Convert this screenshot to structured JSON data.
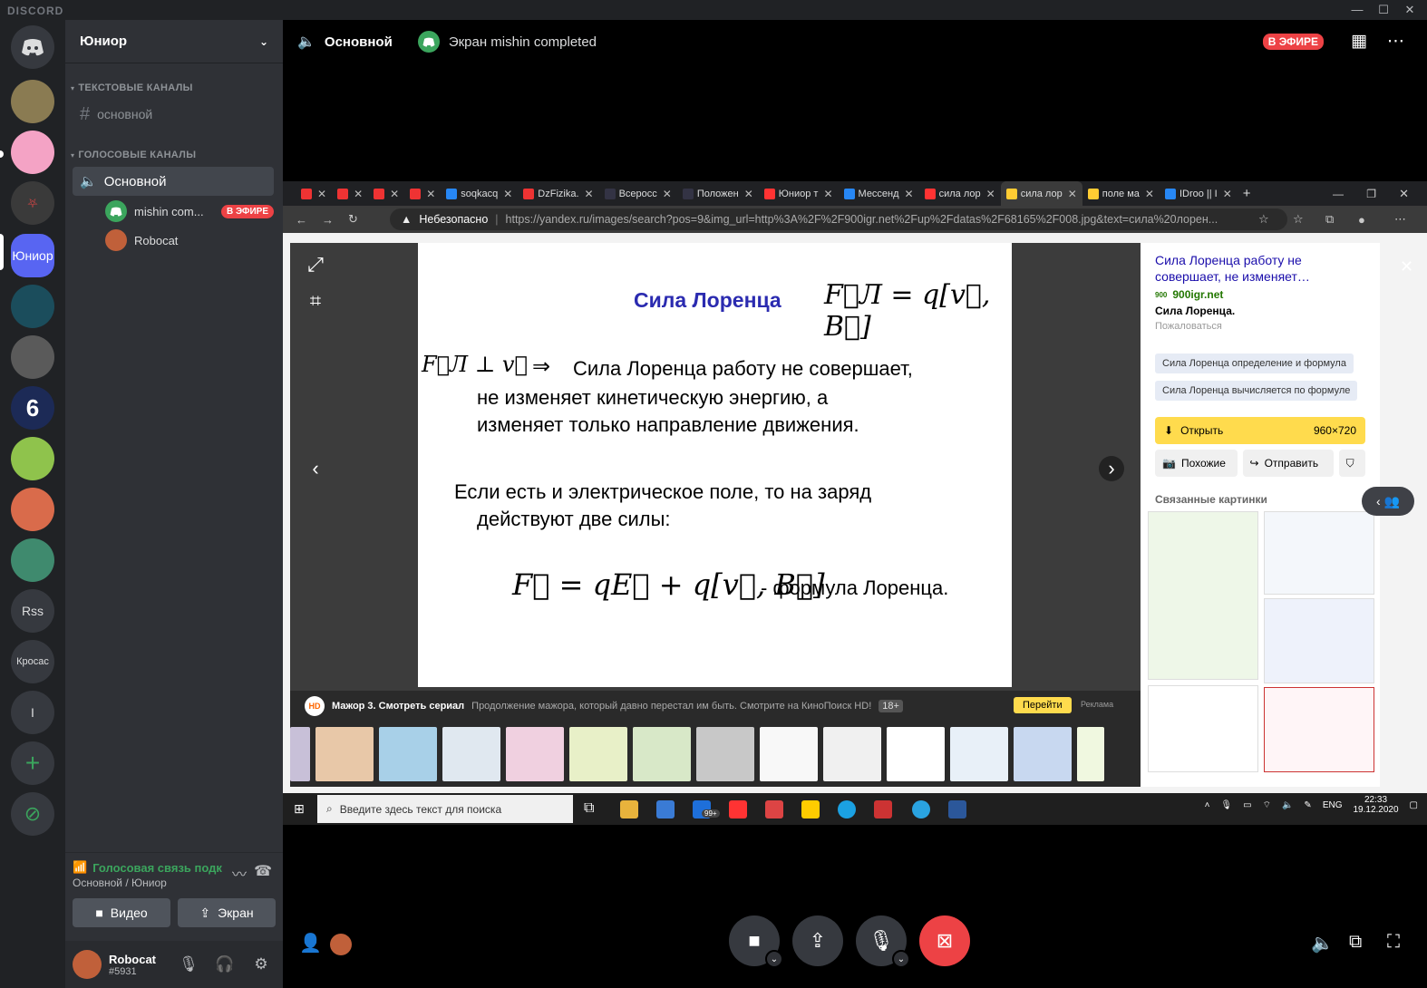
{
  "window": {
    "brand": "DISCORD",
    "controls": [
      "—",
      "☐",
      "✕"
    ]
  },
  "servers": [
    {
      "label": "",
      "kind": "home"
    },
    {
      "label": "",
      "kind": "avatar",
      "color": "#8a7b52"
    },
    {
      "label": "",
      "kind": "avatar",
      "color": "#f4a3c5"
    },
    {
      "label": "",
      "kind": "avatar",
      "color": "#3a3a3a"
    },
    {
      "label": "Юниор",
      "kind": "active"
    },
    {
      "label": "",
      "kind": "avatar",
      "color": "#1b4d5c"
    },
    {
      "label": "",
      "kind": "avatar",
      "color": "#5a5a5a"
    },
    {
      "label": "",
      "kind": "avatar",
      "color": "#1c2a56"
    },
    {
      "label": "",
      "kind": "avatar",
      "color": "#8fc34c"
    },
    {
      "label": "",
      "kind": "avatar",
      "color": "#d96b4b"
    },
    {
      "label": "",
      "kind": "avatar",
      "color": "#3f8a6e"
    },
    {
      "label": "Rss",
      "kind": "text"
    },
    {
      "label": "Кросас",
      "kind": "text"
    },
    {
      "label": "I",
      "kind": "text"
    },
    {
      "label": "+",
      "kind": "add"
    },
    {
      "label": "",
      "kind": "explore"
    }
  ],
  "guild": {
    "name": "Юниор",
    "text_category": "ТЕКСТОВЫЕ КАНАЛЫ",
    "text_channel": "основной",
    "voice_category": "ГОЛОСОВЫЕ КАНАЛЫ",
    "voice_channel": "Основной",
    "voice_users": [
      {
        "name": "mishin com...",
        "badge": "В ЭФИРЕ"
      },
      {
        "name": "Robocat",
        "badge": ""
      }
    ]
  },
  "voice_panel": {
    "status": "Голосовая связь подк",
    "location": "Основной / Юниор",
    "video_label": "Видео",
    "screen_label": "Экран"
  },
  "user": {
    "name": "Robocat",
    "tag": "#5931"
  },
  "stage_header": {
    "channel": "Основной",
    "stream_title": "Экран mishin completed",
    "live_badge": "В ЭФИРЕ"
  },
  "browser": {
    "tabs": [
      {
        "label": "",
        "color": "#e33"
      },
      {
        "label": "",
        "color": "#e33"
      },
      {
        "label": "",
        "color": "#e33"
      },
      {
        "label": "",
        "color": "#e33"
      },
      {
        "label": "soqkacq",
        "color": "#2787f5"
      },
      {
        "label": "DzFizika.",
        "color": "#e33"
      },
      {
        "label": "Всеросс",
        "color": "#334"
      },
      {
        "label": "Положен",
        "color": "#334"
      },
      {
        "label": "Юниор т",
        "color": "#f33"
      },
      {
        "label": "Мессенд",
        "color": "#2787f5"
      },
      {
        "label": "сила лор",
        "color": "#f33"
      },
      {
        "label": "сила лор",
        "color": "#fc3"
      },
      {
        "label": "поле ма",
        "color": "#fc3"
      },
      {
        "label": "IDroo || I",
        "color": "#2787f5"
      }
    ],
    "insecure_label": "Небезопасно",
    "url": "https://yandex.ru/images/search?pos=9&img_url=http%3A%2F%2F900igr.net%2Fup%2Fdatas%2F68165%2F008.jpg&text=сила%20лорен..."
  },
  "slide": {
    "title": "Сила Лоренца",
    "formula_title": "F⃗Л = q[v⃗, B⃗]",
    "perp": "F⃗Л ⊥ v⃗",
    "arrow": "⇒",
    "line1": "Сила Лоренца работу не совершает,",
    "line2": "не изменяет кинетическую энергию, а",
    "line3": "изменяет только направление движения.",
    "line4": "Если есть и электрическое поле, то на заряд",
    "line5": "действуют две силы:",
    "formula_main": "F⃗ = qE⃗ + q[v⃗, B⃗]",
    "formula_caption": "- формула Лоренца."
  },
  "ad": {
    "title": "Мажор 3. Смотреть сериал",
    "text": "Продолжение мажора, который давно перестал им быть. Смотрите на КиноПоиск HD!",
    "age": "18+",
    "button": "Перейти",
    "label": "Реклама"
  },
  "side_panel": {
    "title": "Сила Лоренца работу не совершает, не изменяет…",
    "site": "900igr.net",
    "subtitle": "Сила Лоренца.",
    "complain": "Пожаловаться",
    "chip1": "Сила Лоренца определение и формула",
    "chip2": "Сила Лоренца вычисляется по формуле",
    "open_label": "Открыть",
    "size": "960×720",
    "similar_label": "Похожие",
    "send_label": "Отправить",
    "related_title": "Связанные картинки"
  },
  "taskbar": {
    "search_placeholder": "Введите здесь текст для поиска",
    "mail_badge": "99+",
    "lang": "ENG",
    "time": "22:33",
    "date": "19.12.2020"
  },
  "colors": {
    "discord_bg": "#202225",
    "sidebar": "#2f3136",
    "accent": "#5865f2",
    "live_red": "#ed4245",
    "green": "#3ba55d"
  }
}
